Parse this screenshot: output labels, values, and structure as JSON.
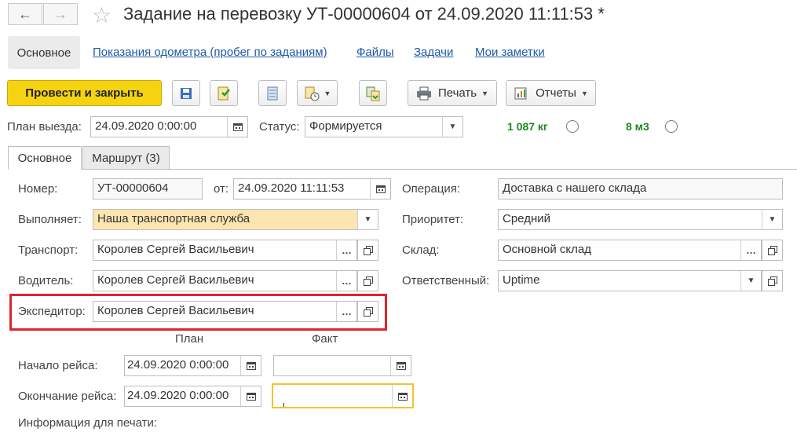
{
  "window": {
    "title": "Задание на перевозку УТ-00000604 от 24.09.2020 11:11:53 *",
    "back_icon": "arrow-left-icon",
    "forward_icon": "arrow-right-icon",
    "favorite_icon": "star-icon"
  },
  "nav": {
    "active": "Основное",
    "links": [
      "Показания одометра (пробег по заданиям)",
      "Файлы",
      "Задачи",
      "Мои заметки"
    ]
  },
  "toolbar": {
    "post_close": "Провести и закрыть",
    "print": "Печать",
    "reports": "Отчеты"
  },
  "header": {
    "plan_label": "План выезда:",
    "plan_value": "24.09.2020  0:00:00",
    "status_label": "Статус:",
    "status_value": "Формируется",
    "weight": "1 087 кг",
    "volume": "8 м3"
  },
  "tabs": [
    "Основное",
    "Маршрут (3)"
  ],
  "form": {
    "number_label": "Номер:",
    "number_value": "УТ-00000604",
    "date_label": "от:",
    "date_value": "24.09.2020 11:11:53",
    "operation_label": "Операция:",
    "operation_value": "Доставка с нашего склада",
    "executor_label": "Выполняет:",
    "executor_value": "Наша транспортная служба",
    "priority_label": "Приоритет:",
    "priority_value": "Средний",
    "transport_label": "Транспорт:",
    "transport_value": "Королев Сергей Васильевич",
    "warehouse_label": "Склад:",
    "warehouse_value": "Основной склад",
    "driver_label": "Водитель:",
    "driver_value": "Королев Сергей Васильевич",
    "responsible_label": "Ответственный:",
    "responsible_value": "Uptime",
    "forwarder_label": "Экспедитор:",
    "forwarder_value": "Королев Сергей Васильевич",
    "plan_col": "План",
    "fact_col": "Факт",
    "trip_start_label": "Начало рейса:",
    "trip_start_plan": "24.09.2020  0:00:00",
    "trip_start_fact": " .  .       :  :",
    "trip_end_label": "Окончание рейса:",
    "trip_end_plan": "24.09.2020  0:00:00",
    "trip_end_fact": " .  .       :  :",
    "print_info_label": "Информация для печати:"
  },
  "colors": {
    "accent": "#f5d311",
    "link": "#1e5aa5",
    "highlight": "#e0242f",
    "green": "#1d8a1d"
  }
}
